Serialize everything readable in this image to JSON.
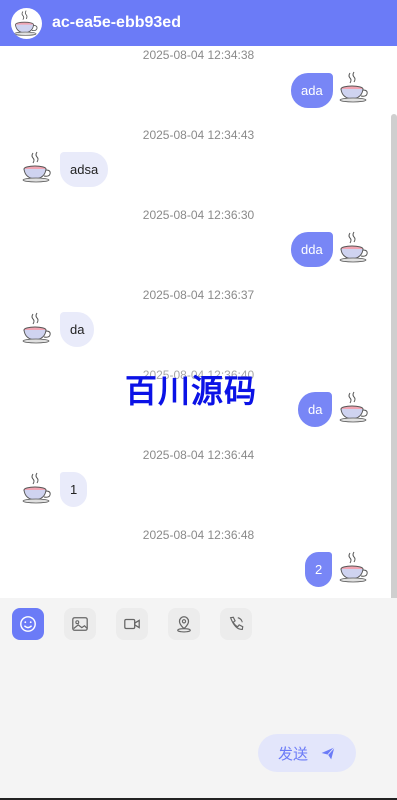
{
  "header": {
    "title": "ac-ea5e-ebb93ed",
    "avatar_icon": "teacup-icon"
  },
  "messages": [
    {
      "time": "2025-08-04 12:34:38",
      "side": "right",
      "text": "ada"
    },
    {
      "time": "2025-08-04 12:34:43",
      "side": "left",
      "text": "adsa"
    },
    {
      "time": "2025-08-04 12:36:30",
      "side": "right",
      "text": "dda"
    },
    {
      "time": "2025-08-04 12:36:37",
      "side": "left",
      "text": "da"
    },
    {
      "time": "2025-08-04 12:36:40",
      "side": "right",
      "text": "da"
    },
    {
      "time": "2025-08-04 12:36:44",
      "side": "left",
      "text": "1"
    },
    {
      "time": "2025-08-04 12:36:48",
      "side": "right",
      "text": "2"
    }
  ],
  "watermark": "百川源码",
  "toolbar": {
    "items": [
      {
        "icon": "emoji-icon",
        "active": true
      },
      {
        "icon": "image-icon",
        "active": false
      },
      {
        "icon": "video-icon",
        "active": false
      },
      {
        "icon": "location-icon",
        "active": false
      },
      {
        "icon": "phone-icon",
        "active": false
      }
    ]
  },
  "composer": {
    "send_label": "发送",
    "send_icon": "paper-plane-icon"
  },
  "colors": {
    "primary": "#6b7bf7",
    "bubble_right": "#7886f6",
    "bubble_left": "#e9ebfa",
    "panel": "#f4f4f4"
  }
}
